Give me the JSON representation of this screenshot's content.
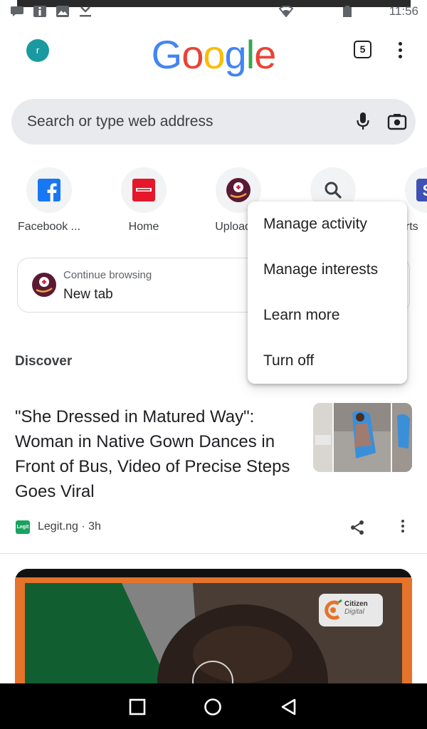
{
  "status_bar": {
    "time": "11:56",
    "left_icons": [
      "message-icon",
      "info-icon",
      "image-icon",
      "download-icon"
    ],
    "right_icons": [
      "wifi-icon",
      "battery-icon"
    ]
  },
  "toolbar": {
    "avatar_initial": "r",
    "logo_letters": [
      {
        "char": "G",
        "color": "#4285f4"
      },
      {
        "char": "o",
        "color": "#ea4335"
      },
      {
        "char": "o",
        "color": "#fbbc05"
      },
      {
        "char": "g",
        "color": "#4285f4"
      },
      {
        "char": "l",
        "color": "#34a853"
      },
      {
        "char": "e",
        "color": "#ea4335"
      }
    ],
    "tab_count": "5"
  },
  "search": {
    "placeholder": "Search or type web address"
  },
  "shortcuts": [
    {
      "label": "Facebook ...",
      "icon": "facebook-icon"
    },
    {
      "label": "Home",
      "icon": "espn-icon"
    },
    {
      "label": "Upload Y",
      "icon": "upload-icon"
    },
    {
      "label": "",
      "icon": "search-icon"
    },
    {
      "label": "orts",
      "icon": "s-icon"
    }
  ],
  "continue_browsing": {
    "subtitle": "Continue browsing",
    "title": "New tab"
  },
  "discover": {
    "heading": "Discover"
  },
  "article": {
    "title": "\"She Dressed in Matured Way\": Woman in Native Gown Dances in Front of Bus, Video of Precise Steps Goes Viral",
    "source": "Legit.ng · 3h",
    "source_badge": "Legit"
  },
  "video_card": {
    "badge_line1": "Citizen",
    "badge_line2": "Digital"
  },
  "popup_menu": {
    "items": [
      "Manage activity",
      "Manage interests",
      "Learn more",
      "Turn off"
    ]
  },
  "colors": {
    "accent_blue": "#4285f4",
    "search_bg": "#e8eaed",
    "avatar_bg": "#1a9aa0",
    "video_border": "#e5732a"
  }
}
